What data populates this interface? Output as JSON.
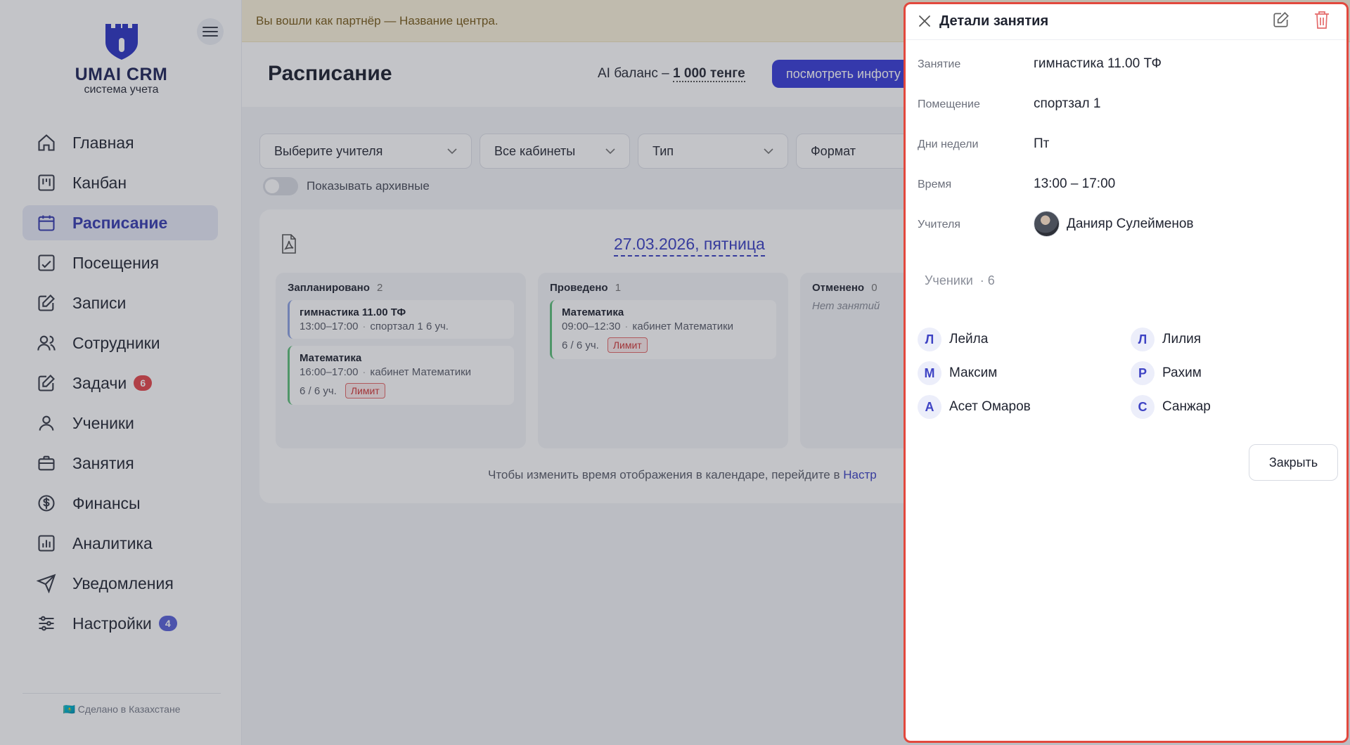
{
  "sidebar": {
    "logo_title": "UMAI CRM",
    "logo_sub": "система учета",
    "items": [
      {
        "label": "Главная",
        "icon": "home-icon"
      },
      {
        "label": "Канбан",
        "icon": "kanban-icon"
      },
      {
        "label": "Расписание",
        "icon": "calendar-icon",
        "active": true
      },
      {
        "label": "Посещения",
        "icon": "chart-check-icon"
      },
      {
        "label": "Записи",
        "icon": "edit-icon"
      },
      {
        "label": "Сотрудники",
        "icon": "users-icon"
      },
      {
        "label": "Задачи",
        "icon": "edit-icon",
        "badge": "6"
      },
      {
        "label": "Ученики",
        "icon": "user-icon"
      },
      {
        "label": "Занятия",
        "icon": "briefcase-icon"
      },
      {
        "label": "Финансы",
        "icon": "dollar-icon"
      },
      {
        "label": "Аналитика",
        "icon": "bar-chart-icon"
      },
      {
        "label": "Уведомления",
        "icon": "send-icon"
      },
      {
        "label": "Настройки",
        "icon": "sliders-icon",
        "badge": "4"
      }
    ],
    "footer": "🇰🇿 Сделано в Казахстане"
  },
  "banner": "Вы вошли как партнёр — Название центра.",
  "header": {
    "title": "Расписание",
    "ai_label": "AI баланс –",
    "ai_value": "1 000 тенге",
    "info_button": "посмотреть инфоту"
  },
  "filters": {
    "teacher": "Выберите учителя",
    "rooms": "Все кабинеты",
    "type": "Тип",
    "format": "Формат",
    "archive_label": "Показывать архивные"
  },
  "calendar": {
    "date": "27.03.2026, пятница",
    "columns": [
      {
        "title": "Запланировано",
        "count": "2"
      },
      {
        "title": "Проведено",
        "count": "1"
      },
      {
        "title": "Отменено",
        "count": "0",
        "empty": "Нет занятий"
      }
    ],
    "lessons": {
      "p1": {
        "name": "гимнастика 11.00 ТФ",
        "time": "13:00–17:00",
        "room": "спортзал 1",
        "students": "6 уч."
      },
      "p2": {
        "name": "Математика",
        "time": "16:00–17:00",
        "room": "кабинет Математики",
        "count": "6 / 6 уч.",
        "limit": "Лимит"
      },
      "d1": {
        "name": "Математика",
        "time": "09:00–12:30",
        "room": "кабинет Математики",
        "count": "6 / 6 уч.",
        "limit": "Лимит"
      }
    },
    "hint": "Чтобы изменить время отображения в календаре, перейдите в",
    "hint_link": "Настр"
  },
  "drawer": {
    "title": "Детали занятия",
    "rows": [
      {
        "label": "Занятие",
        "value": "гимнастика 11.00 ТФ"
      },
      {
        "label": "Помещение",
        "value": "спортзал 1"
      },
      {
        "label": "Дни недели",
        "value": "Пт"
      },
      {
        "label": "Время",
        "value": "13:00 – 17:00"
      },
      {
        "label": "Учителя",
        "value": "Данияр Сулейменов"
      }
    ],
    "students_title": "Ученики",
    "students_count": "· 6",
    "students": [
      {
        "initial": "Л",
        "name": "Лейла"
      },
      {
        "initial": "Л",
        "name": "Лилия"
      },
      {
        "initial": "М",
        "name": "Максим"
      },
      {
        "initial": "Р",
        "name": "Рахим"
      },
      {
        "initial": "А",
        "name": "Асет Омаров"
      },
      {
        "initial": "С",
        "name": "Санжар"
      }
    ],
    "close_button": "Закрыть"
  }
}
